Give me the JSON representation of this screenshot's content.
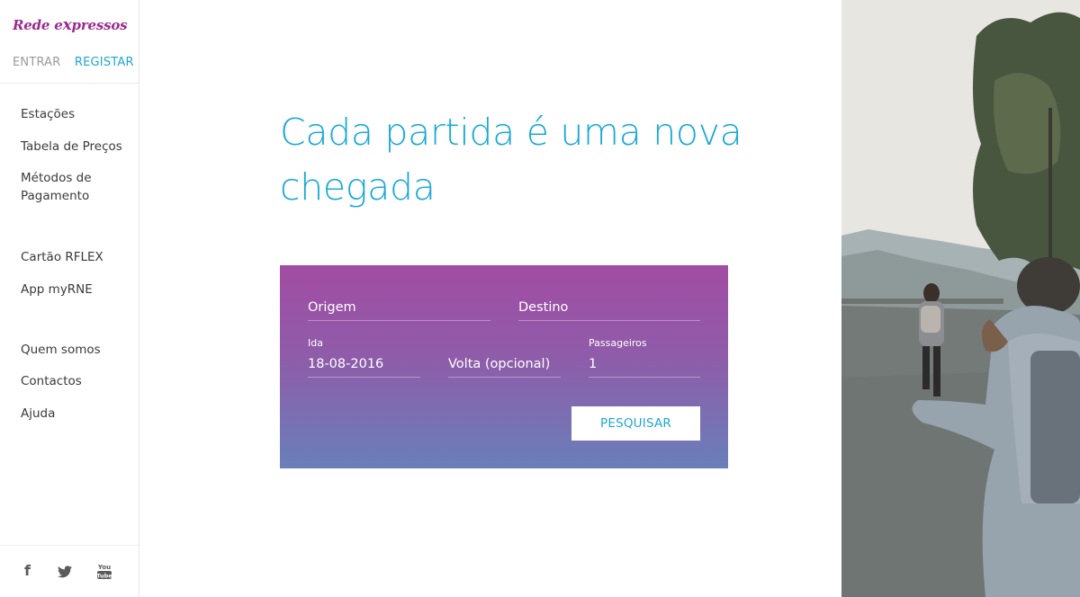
{
  "brand": {
    "logo_text_1": "Rede e",
    "logo_text_x": "x",
    "logo_text_2": "pressos"
  },
  "auth": {
    "login_label": "ENTRAR",
    "register_label": "REGISTAR"
  },
  "nav": {
    "group1": [
      "Estações",
      "Tabela de Preços",
      "Métodos de Pagamento"
    ],
    "group2": [
      "Cartão RFLEX",
      "App myRNE"
    ],
    "group3": [
      "Quem somos",
      "Contactos",
      "Ajuda"
    ]
  },
  "social": {
    "facebook_glyph": "f",
    "youtube_text_1": "You",
    "youtube_text_2": "Tube"
  },
  "hero": {
    "headline": "Cada partida é uma nova chegada"
  },
  "search": {
    "origin_placeholder": "Origem",
    "destination_placeholder": "Destino",
    "departure_label": "Ida",
    "departure_value": "18-08-2016",
    "return_placeholder": "Volta (opcional)",
    "passengers_label": "Passageiros",
    "passengers_value": "1",
    "submit_label": "PESQUISAR"
  },
  "colors": {
    "brand_purple": "#9c2a8c",
    "accent_blue": "#1aa9d6",
    "gradient_top": "#a24ca3",
    "gradient_bottom": "#6a7fba"
  }
}
